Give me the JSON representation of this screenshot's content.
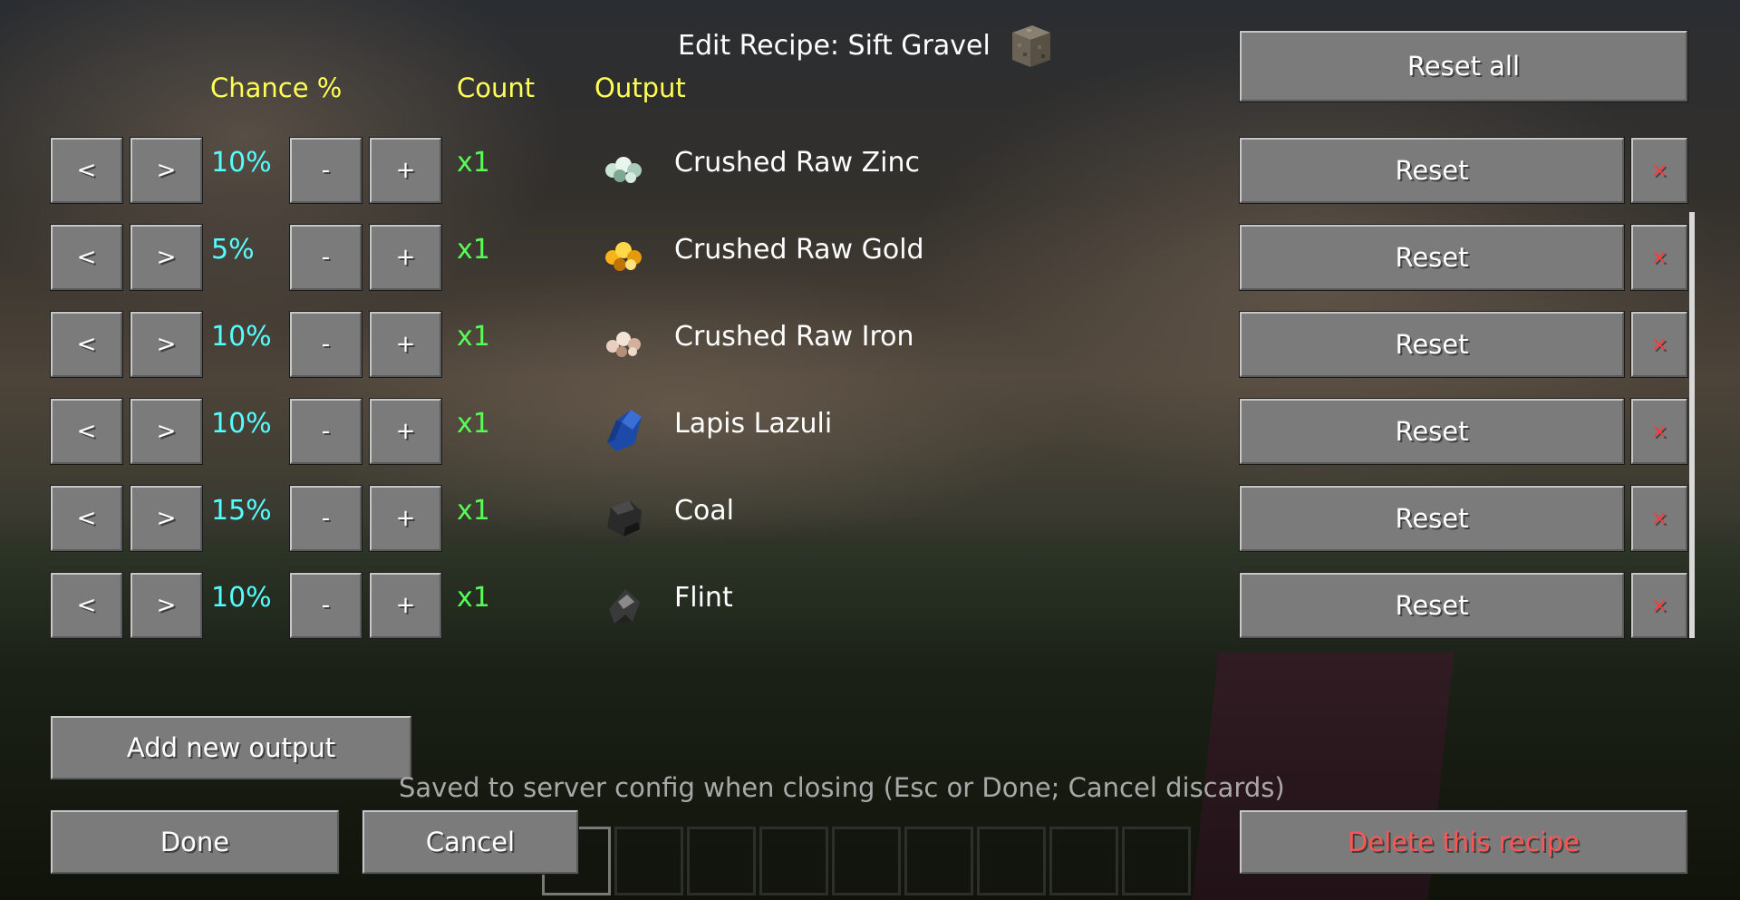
{
  "title": "Edit Recipe: Sift Gravel",
  "headers": {
    "chance": "Chance %",
    "count": "Count",
    "output": "Output"
  },
  "reset_all_label": "Reset all",
  "rows": [
    {
      "prev": "<",
      "next": ">",
      "chance": "10%",
      "minus": "-",
      "plus": "+",
      "count": "x1",
      "name": "Crushed Raw Zinc",
      "icon": "crushed-raw-zinc-icon",
      "reset": "Reset",
      "remove": "×"
    },
    {
      "prev": "<",
      "next": ">",
      "chance": "5%",
      "minus": "-",
      "plus": "+",
      "count": "x1",
      "name": "Crushed Raw Gold",
      "icon": "crushed-raw-gold-icon",
      "reset": "Reset",
      "remove": "×"
    },
    {
      "prev": "<",
      "next": ">",
      "chance": "10%",
      "minus": "-",
      "plus": "+",
      "count": "x1",
      "name": "Crushed Raw Iron",
      "icon": "crushed-raw-iron-icon",
      "reset": "Reset",
      "remove": "×"
    },
    {
      "prev": "<",
      "next": ">",
      "chance": "10%",
      "minus": "-",
      "plus": "+",
      "count": "x1",
      "name": "Lapis Lazuli",
      "icon": "lapis-lazuli-icon",
      "reset": "Reset",
      "remove": "×"
    },
    {
      "prev": "<",
      "next": ">",
      "chance": "15%",
      "minus": "-",
      "plus": "+",
      "count": "x1",
      "name": "Coal",
      "icon": "coal-icon",
      "reset": "Reset",
      "remove": "×"
    },
    {
      "prev": "<",
      "next": ">",
      "chance": "10%",
      "minus": "-",
      "plus": "+",
      "count": "x1",
      "name": "Flint",
      "icon": "flint-icon",
      "reset": "Reset",
      "remove": "×"
    }
  ],
  "add_output_label": "Add new output",
  "note": "Saved to server config when closing (Esc or Done; Cancel discards)",
  "done_label": "Done",
  "cancel_label": "Cancel",
  "delete_label": "Delete this recipe",
  "colors": {
    "header": "#ffff55",
    "chance": "#55ffff",
    "count": "#55ff55",
    "delete": "#ff5555",
    "button": "#7b7b7b"
  }
}
